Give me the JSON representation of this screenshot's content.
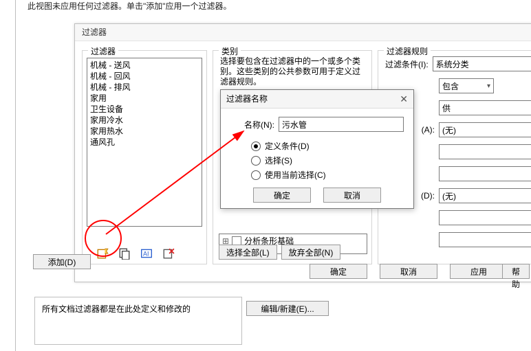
{
  "top_hint": "此视图未应用任何过滤器。单击\"添加\"应用一个过滤器。",
  "dialog": {
    "title": "过滤器"
  },
  "filters": {
    "legend": "过滤器",
    "items": [
      "机械 - 送风",
      "机械 - 回风",
      "机械 - 排风",
      "家用",
      "卫生设备",
      "家用冷水",
      "家用热水",
      "通风孔"
    ]
  },
  "categories": {
    "legend": "类别",
    "desc": "选择要包含在过滤器中的一个或多个类别。这些类别的公共参数可用于定义过滤器规则。",
    "tree": [
      "分析条形基础"
    ],
    "select_all": "选择全部(L)",
    "discard_all": "放弃全部(N)"
  },
  "rules": {
    "legend": "过滤器规则",
    "cond_label": "过滤条件(I):",
    "cond_value": "系统分类",
    "contains_label": "包含",
    "contains_value": "供",
    "a_label": "(A):",
    "a_value": "(无)",
    "d_label": "(D):",
    "d_value": "(无)"
  },
  "footer": {
    "ok": "确定",
    "cancel": "取消",
    "apply": "应用",
    "help": "帮助"
  },
  "side": {
    "add": "添加(D)"
  },
  "doc_label": "所有文档过滤器都是在此处定义和修改的",
  "edit_new": "编辑/新建(E)...",
  "modal": {
    "title": "过滤器名称",
    "name_label": "名称(N):",
    "name_value": "污水管",
    "radio_define": "定义条件(D)",
    "radio_select": "选择(S)",
    "radio_use_current": "使用当前选择(C)",
    "ok": "确定",
    "cancel": "取消"
  },
  "icons": {
    "new": "new-filter-icon",
    "copy": "copy-icon",
    "rename": "rename-icon",
    "delete": "delete-icon"
  }
}
